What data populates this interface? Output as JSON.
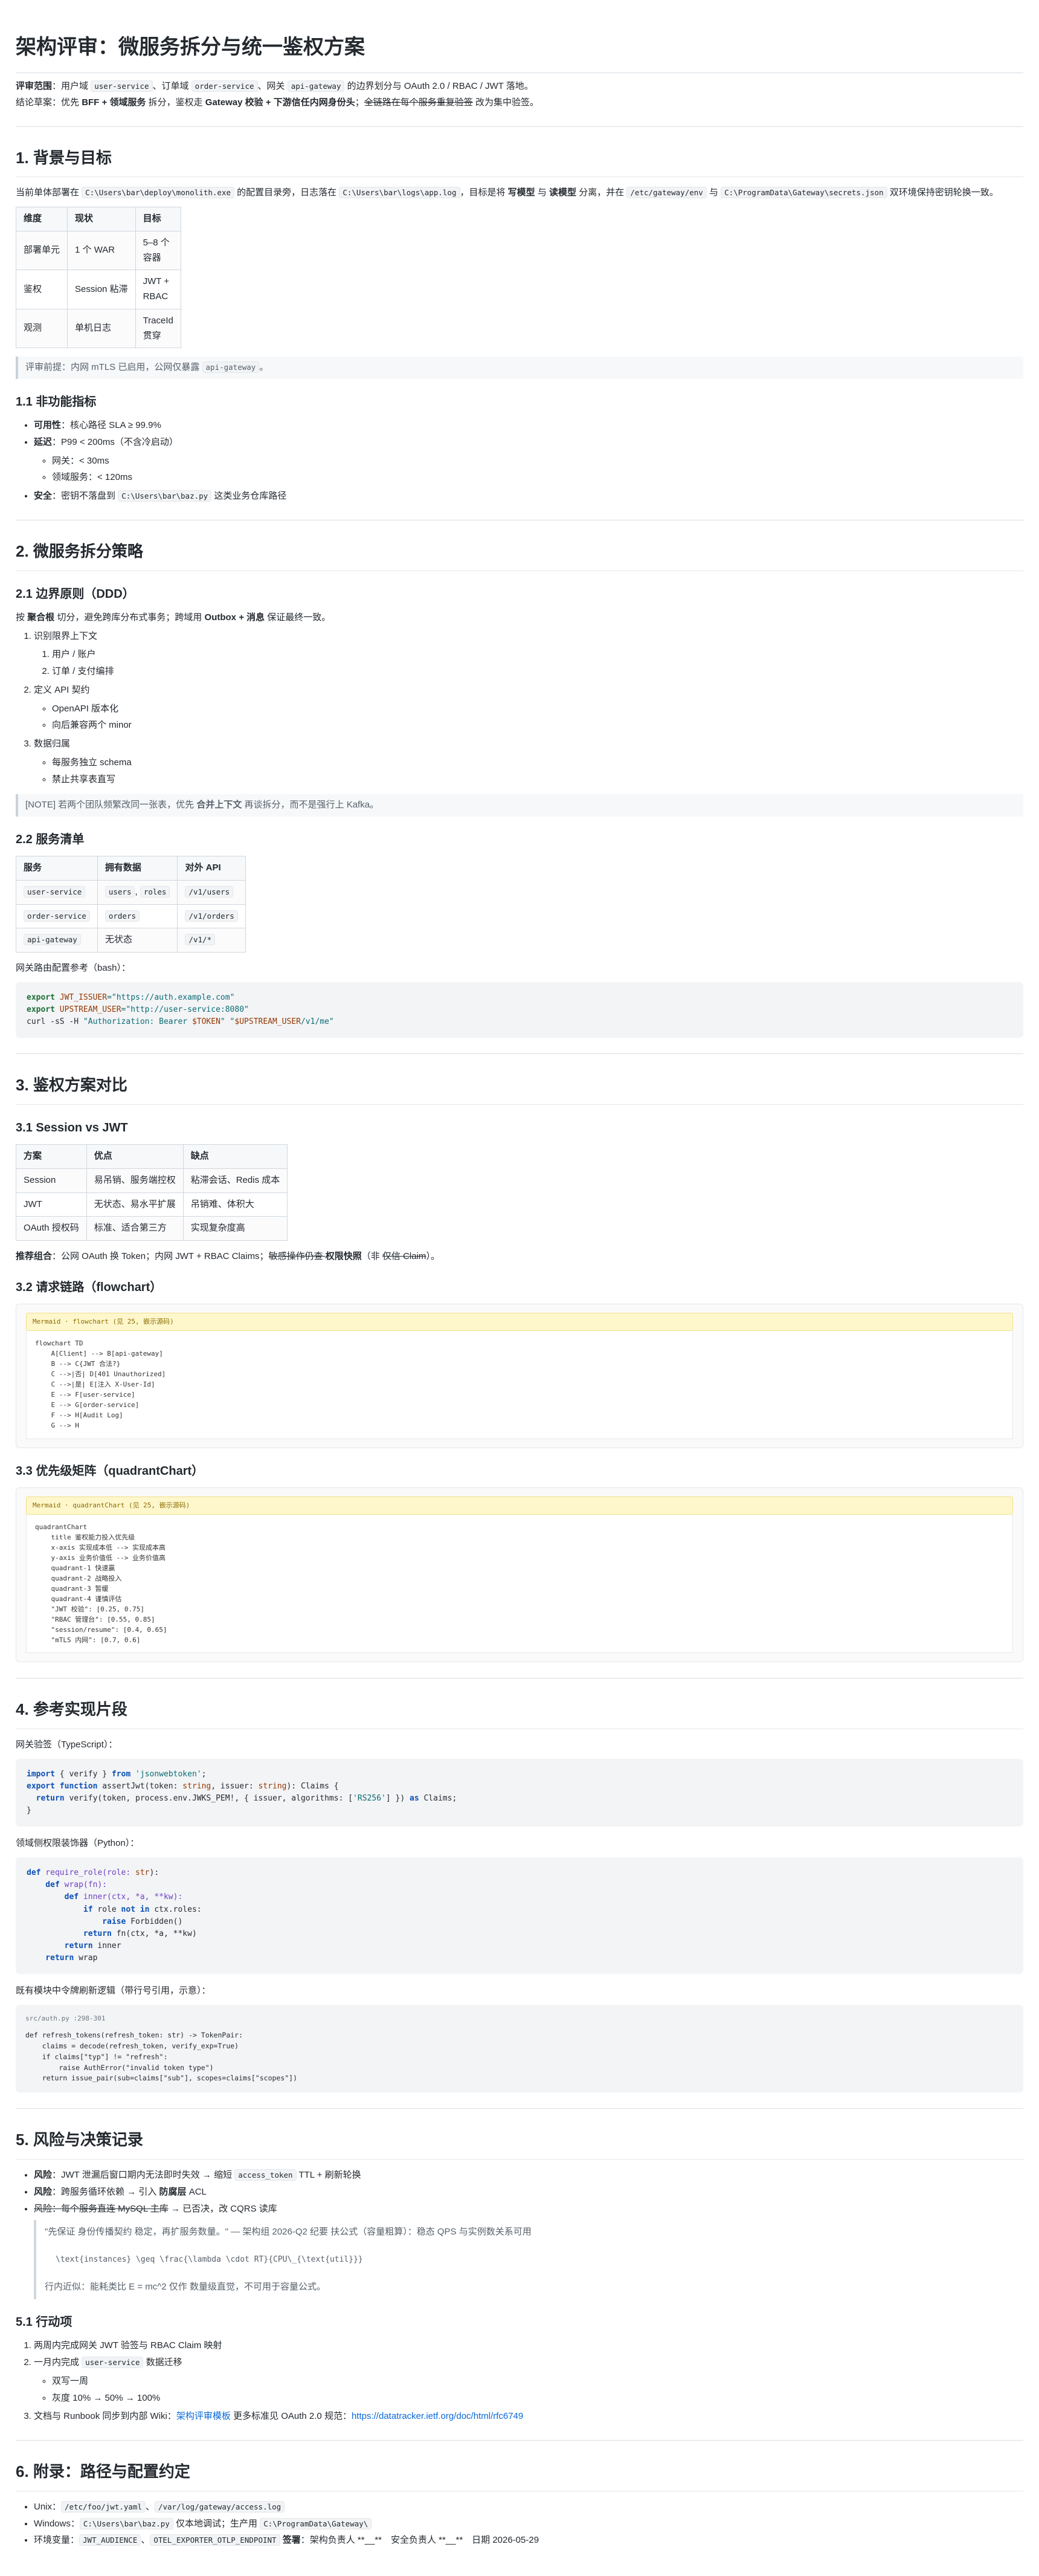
{
  "title": "架构评审：微服务拆分与统一鉴权方案",
  "meta": {
    "scope_label": "评审范围",
    "scope_parts": [
      "：用户域 ",
      "user-service",
      "、订单域 ",
      "order-service",
      "、网关 ",
      "api-gateway",
      " 的边界划分与 OAuth 2.0 / RBAC / JWT 落地。"
    ],
    "summary_label": "结论草案",
    "summary_parts": [
      "：优先 ",
      "BFF + 领域服务",
      " 拆分，鉴权走 ",
      "Gateway 校验 + 下游信任内网身份头",
      "；",
      "全链路在每个服务重复验签",
      " 改为集中验签。"
    ]
  },
  "s1": {
    "heading": "1. 背景与目标",
    "intro_parts": [
      "当前单体部署在 ",
      "C:\\Users\\bar\\deploy\\monolith.exe",
      " 的配置目录旁，日志落在 ",
      "C:\\Users\\bar\\logs\\app.log",
      "，目标是将 ",
      "写模型",
      " 与 ",
      "读模型",
      " 分离，并在 ",
      "/etc/gateway/env",
      " 与 ",
      "C:\\ProgramData\\Gateway\\secrets.json",
      " 双环境保持密钥轮换一致。"
    ],
    "table": {
      "headers": [
        "维度",
        "现状",
        "目标"
      ],
      "rows": [
        [
          "部署单元",
          "1 个 WAR",
          "5–8 个容器"
        ],
        [
          "鉴权",
          "Session 粘滞",
          "JWT + RBAC"
        ],
        [
          "观测",
          "单机日志",
          "TraceId 贯穿"
        ]
      ]
    },
    "note_parts": [
      "评审前提：内网 mTLS 已启用，公网仅暴露 ",
      "api-gateway",
      "。"
    ],
    "sub_heading": "1.1 非功能指标",
    "nfr": {
      "a_label": "可用性",
      "a_text": "：核心路径 SLA ≥ 99.9%",
      "b_label": "延迟",
      "b_text": "：P99 < 200ms（不含冷启动）",
      "b_sub": [
        "网关：< 30ms",
        "领域服务：< 120ms"
      ],
      "c_label": "安全",
      "c_text": "：密钥不落盘到 ",
      "c_code": "C:\\Users\\bar\\baz.py",
      "c_tail": " 这类业务仓库路径"
    }
  },
  "s2": {
    "heading": "2. 微服务拆分策略",
    "sub1": "2.1 边界原则（DDD）",
    "principle_parts": [
      "按 ",
      "聚合根",
      " 切分，避免跨库分布式事务；跨域用 ",
      "Outbox + 消息",
      " 保证最终一致。"
    ],
    "steps": [
      {
        "label": "识别限界上下文",
        "subs": [
          "用户 / 账户",
          "订单 / 支付编排"
        ]
      },
      {
        "label": "定义 API 契约",
        "subs": [
          "OpenAPI 版本化",
          "向后兼容两个 minor"
        ]
      },
      {
        "label": "数据归属",
        "subs": [
          "每服务独立 schema",
          "禁止共享表直写"
        ]
      }
    ],
    "note2_parts": [
      "[NOTE] 若两个团队频繁改同一张表，优先 ",
      "合并上下文",
      " 再谈拆分，而不是强行上 Kafka。"
    ],
    "sub2": "2.2 服务清单",
    "svc_headers": [
      "服务",
      "拥有数据",
      "对外 API"
    ],
    "svc_rows": [
      {
        "svc": "user-service",
        "data": [
          "users",
          "roles"
        ],
        "api": "/v1/users"
      },
      {
        "svc": "order-service",
        "data": [
          "orders"
        ],
        "api": "/v1/orders"
      },
      {
        "svc": "api-gateway",
        "data_text": "无状态",
        "api": "/v1/*"
      }
    ],
    "bash_label": "网关路由配置参考（bash）：",
    "bash": {
      "export": "export",
      "v1": "JWT_ISSUER",
      "v1val": "=\"https://auth.example.com\"",
      "v2": "UPSTREAM_USER",
      "v2val": "=\"http://user-service:8080\"",
      "curl": "curl -sS -H ",
      "hdr_a": "\"Authorization: Bearer ",
      "tok": "$TOKEN",
      "hdr_b": "\"",
      "u1": " \"",
      "uvar": "$UPSTREAM_USER",
      "u2": "/v1/me\""
    }
  },
  "s3": {
    "heading": "3. 鉴权方案对比",
    "sub1": "3.1 Session vs JWT",
    "cmp_headers": [
      "方案",
      "优点",
      "缺点"
    ],
    "cmp_rows": [
      [
        "Session",
        "易吊销、服务端控权",
        "粘滞会话、Redis 成本"
      ],
      [
        "JWT",
        "无状态、易水平扩展",
        "吊销难、体积大"
      ],
      [
        "OAuth 授权码",
        "标准、适合第三方",
        "实现复杂度高"
      ]
    ],
    "rec_parts": [
      "推荐组合",
      "：公网 OAuth 换 Token；内网 JWT + RBAC Claims；",
      "敏感操作仍查 ",
      "权限快照",
      "（非 ",
      "仅信 Claim",
      "）。"
    ],
    "sub2": "3.2 请求链路（flowchart）",
    "flow_head": "Mermaid · flowchart (见 25, 嵌示源码)",
    "flow_code": "flowchart TD\n    A[Client] --> B[api-gateway]\n    B --> C{JWT 合法?}\n    C -->|否| D[401 Unauthorized]\n    C -->|是| E[注入 X-User-Id]\n    E --> F[user-service]\n    E --> G[order-service]\n    F --> H[Audit Log]\n    G --> H",
    "sub3": "3.3 优先级矩阵（quadrantChart）",
    "quad_head": "Mermaid · quadrantChart (见 25, 嵌示源码)",
    "quad_code": "quadrantChart\n    title 鉴权能力投入优先级\n    x-axis 实现成本低 --> 实现成本高\n    y-axis 业务价值低 --> 业务价值高\n    quadrant-1 快速赢\n    quadrant-2 战略投入\n    quadrant-3 暂缓\n    quadrant-4 谨慎评估\n    \"JWT 校验\": [0.25, 0.75]\n    \"RBAC 管理台\": [0.55, 0.85]\n    \"session/resume\": [0.4, 0.65]\n    \"mTLS 内网\": [0.7, 0.6]"
  },
  "s4": {
    "heading": "4. 参考实现片段",
    "ts_label": "网关验签（TypeScript）：",
    "ts": {
      "l1a": "import",
      "l1b": " { verify } ",
      "l1c": "from",
      "l1d": " 'jsonwebtoken'",
      "l1e": ";",
      "l2a": "export function",
      "l2b": " assertJwt(token: ",
      "l2c": "string",
      "l2d": ", issuer: ",
      "l2e": "string",
      "l2f": "): Claims {",
      "l3a": "  ",
      "l3b": "return",
      "l3c": " verify(token, process.env.JWKS_PEM!, { issuer, algorithms: [",
      "l3d": "'RS256'",
      "l3e": "] }) ",
      "l3f": "as",
      "l3g": " Claims;",
      "l4": "}"
    },
    "py_label": "领域侧权限装饰器（Python）：",
    "py_lines": [
      [
        "def",
        " require_role(role: ",
        "str",
        "):"
      ],
      [
        "    def",
        " wrap(fn):",
        "",
        ""
      ],
      [
        "        def",
        " inner(ctx, *a, **kw):",
        "",
        ""
      ],
      [
        "            if",
        " role ",
        "not in",
        " ctx.roles:"
      ],
      [
        "                raise",
        " Forbidden()",
        "",
        ""
      ],
      [
        "            return",
        " fn(ctx, *a, **kw)",
        "",
        ""
      ],
      [
        "        return",
        " inner",
        "",
        ""
      ],
      [
        "    return",
        " wrap",
        "",
        ""
      ]
    ],
    "snip_label": "既有模块中令牌刷新逻辑（带行号引用，示意）：",
    "snip_head": "src/auth.py :298-301",
    "snip_code": "def refresh_tokens(refresh_token: str) -> TokenPair:\n    claims = decode(refresh_token, verify_exp=True)\n    if claims[\"typ\"] != \"refresh\":\n        raise AuthError(\"invalid token type\")\n    return issue_pair(sub=claims[\"sub\"], scopes=claims[\"scopes\"])"
  },
  "s5": {
    "heading": "5. 风险与决策记录",
    "r1_label": "风险",
    "r1_a": "：JWT 泄漏后窗口期内无法即时失效 → 缩短 ",
    "r1_code": "access_token",
    "r1_b": " TTL + 刷新轮换",
    "r2_label": "风险",
    "r2_a": "：跨服务循环依赖 → 引入 ",
    "r2_b": "防腐层",
    "r2_c": " ACL",
    "r3_strike": "风险：每个服务直连 MySQL 主库",
    "r3_tail": " → 已否决，改 CQRS 读库",
    "quote1": "\"先保证 身份传播契约 稳定，再扩服务数量。\" — 架构组 2026-Q2 纪要 扶公式（容量粗算）：稳态 QPS 与实例数关系可用",
    "math": "\\text{instances} \\geq \\frac{\\lambda \\cdot RT}{CPU\\_{\\text{util}}}",
    "quote2": "行内近似：能耗类比 E = mc^2 仅作 数量级直觉，不可用于容量公式。",
    "sub": "5.1 行动项",
    "acts": [
      {
        "label": "两周内完成网关 JWT 验签与 RBAC Claim 映射"
      },
      {
        "label_a": "一月内完成 ",
        "label_code": "user-service",
        "label_b": " 数据迁移",
        "subs": [
          "双写一周",
          "灰度 10% → 50% → 100%"
        ]
      },
      {
        "label_a": "文档与 Runbook 同步到内部 Wiki：",
        "link1": "架构评审模板",
        "label_b": " 更多标准见 OAuth 2.0 规范：",
        "link2": "https://datatracker.ietf.org/doc/html/rfc6749"
      }
    ]
  },
  "s6": {
    "heading": "6. 附录：路径与配置约定",
    "u_label": "Unix",
    "u_c1": "/etc/foo/jwt.yaml",
    "u_c2": "/var/log/gateway/access.log",
    "w_label": "Windows",
    "w_c1": "C:\\Users\\bar\\baz.py",
    "w_mid": " 仅本地调试；生产用 ",
    "w_c2": "C:\\ProgramData\\Gateway\\",
    "e_label": "环境变量",
    "e_c1": "JWT_AUDIENCE",
    "e_c2": "OTEL_EXPORTER_OTLP_ENDPOINT",
    "e_sign": "签署",
    "e_tail": "：架构负责人 **__**　安全负责人 **__**　日期 2026-05-29"
  }
}
